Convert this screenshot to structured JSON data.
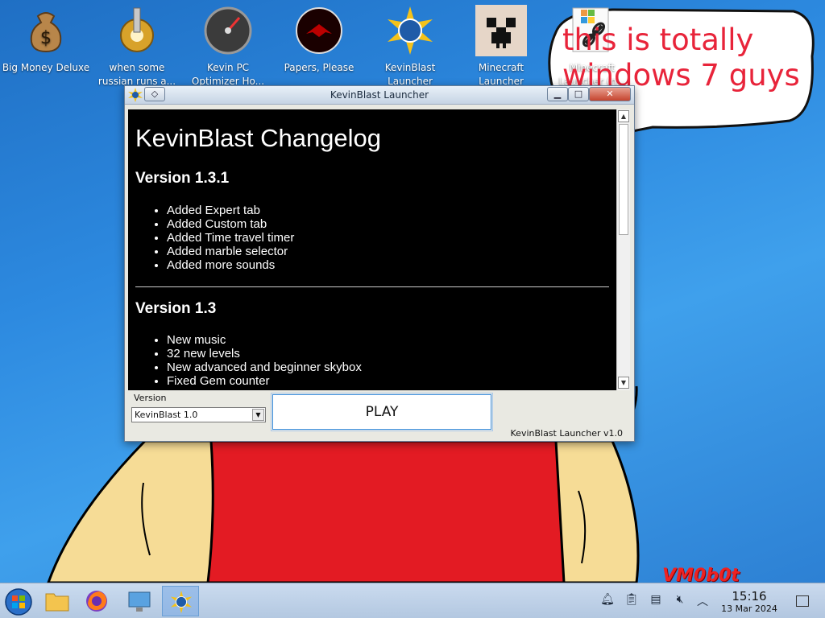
{
  "desktop": {
    "icons": [
      {
        "label": "Big Money Deluxe",
        "icon": "money-bag-icon"
      },
      {
        "label": "when some russian runs a...",
        "icon": "gear-icon"
      },
      {
        "label": "Kevin PC Optimizer Ho...",
        "icon": "speedometer-icon"
      },
      {
        "label": "Papers, Please",
        "icon": "papers-please-icon"
      },
      {
        "label": "KevinBlast Launcher",
        "icon": "kevinblast-icon"
      },
      {
        "label": "Minecraft Launcher",
        "icon": "creeper-icon"
      },
      {
        "label": "Minecraft Launcher (n...",
        "icon": "shortcut-link-icon"
      }
    ],
    "bubble_text": "this is totally windows 7 guys",
    "watermark": "VM0b0t"
  },
  "window": {
    "title": "KevinBlast Launcher",
    "changelog": {
      "heading": "KevinBlast Changelog",
      "sections": [
        {
          "version": "Version 1.3.1",
          "items": [
            "Added Expert tab",
            "Added Custom tab",
            "Added Time travel timer",
            "Added marble selector",
            "Added more sounds"
          ]
        },
        {
          "version": "Version 1.3",
          "items": [
            "New music",
            "32 new levels",
            "New advanced and beginner skybox",
            "Fixed Gem counter"
          ]
        }
      ]
    },
    "version_label": "Version",
    "version_selected": "KevinBlast 1.0",
    "play_label": "PLAY",
    "footer": "KevinBlast Launcher v1.0",
    "buttons": {
      "minimize": "▁",
      "maximize": "□",
      "close": "✕"
    }
  },
  "taskbar": {
    "time": "15:16",
    "date": "13 Mar 2024"
  },
  "colors": {
    "wallpaper_blue": "#2d8ae0",
    "bubble_text": "#e8243a",
    "shirt_red": "#e31b23",
    "skin": "#f6dc96"
  }
}
